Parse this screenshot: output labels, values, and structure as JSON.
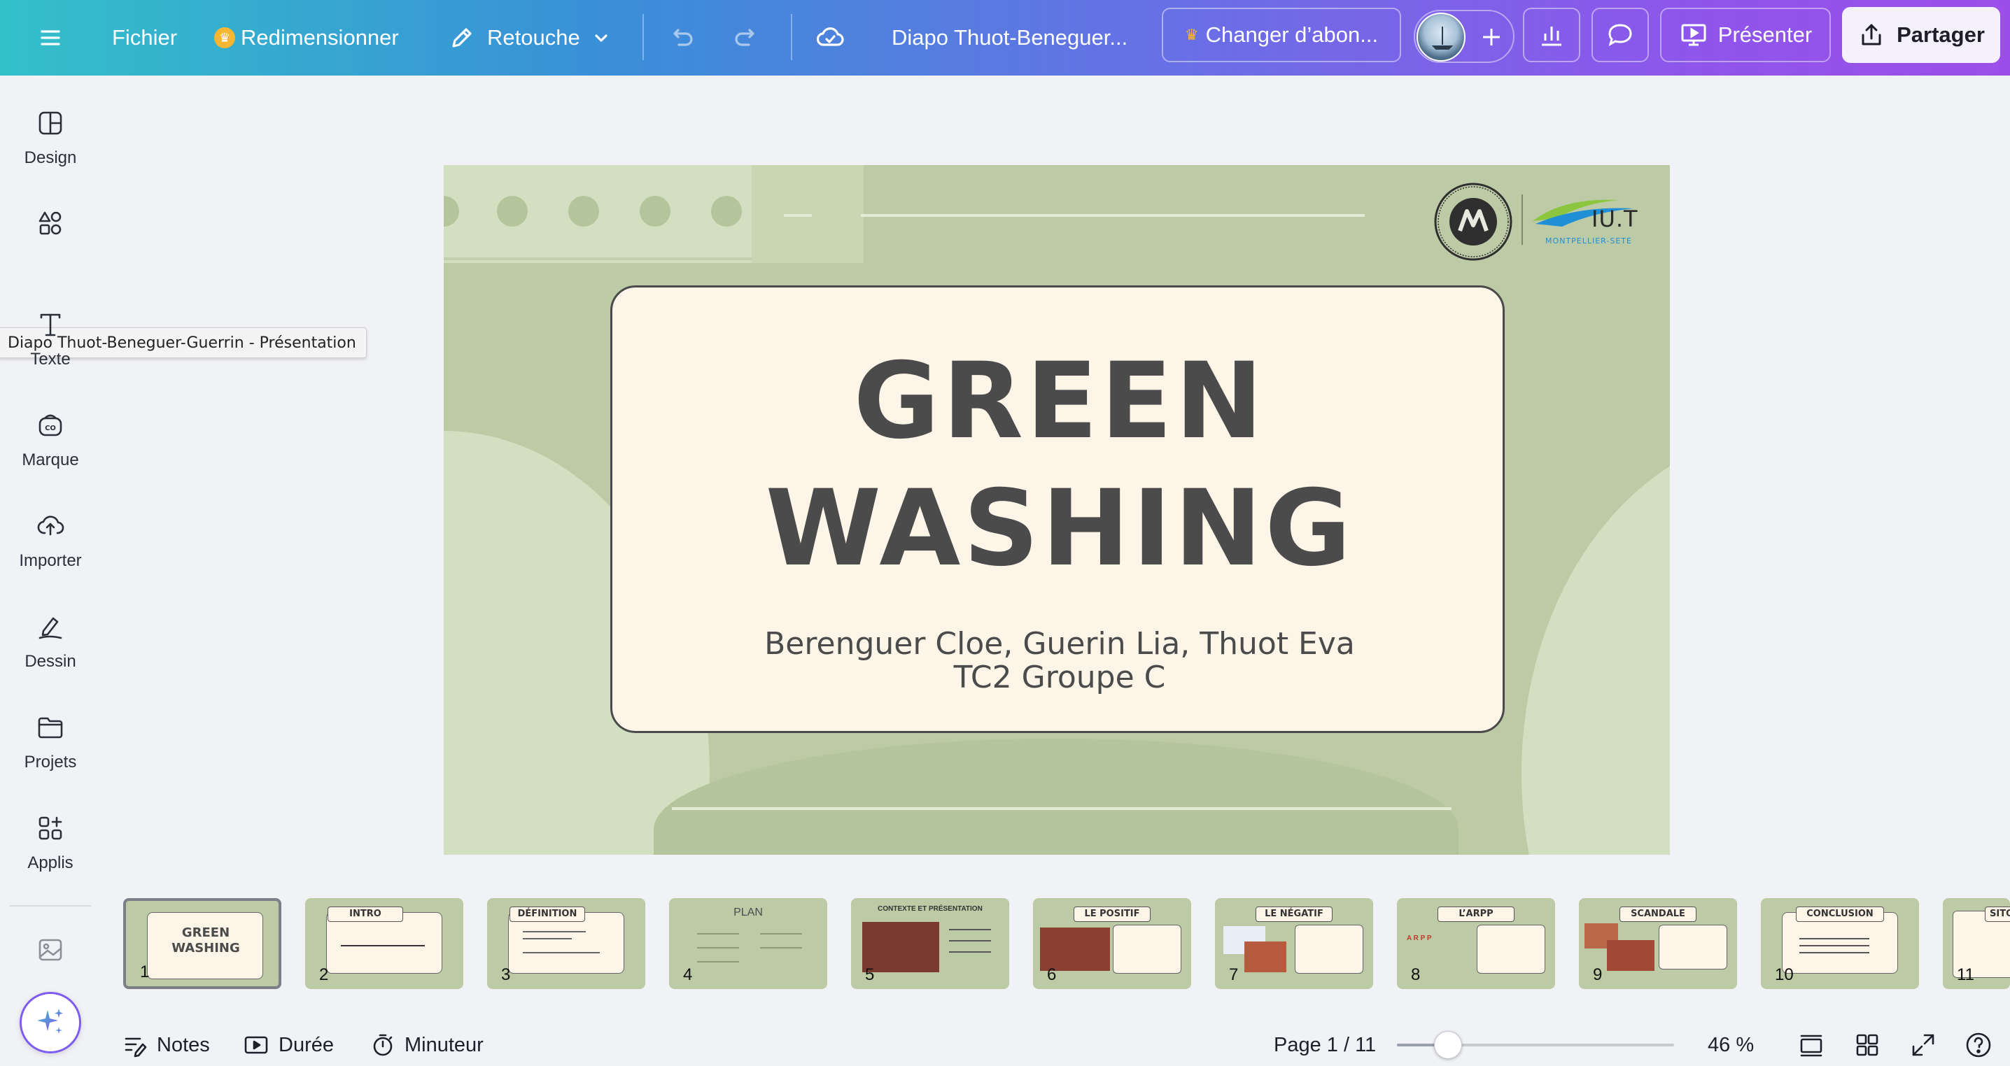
{
  "topbar": {
    "menu_icon": "hamburger-icon",
    "file_label": "Fichier",
    "resize_label": "Redimensionner",
    "edit_label": "Retouche",
    "doc_title": "Diapo Thuot-Beneguer...",
    "upgrade_label": "Changer d’abon...",
    "present_label": "Présenter",
    "share_label": "Partager"
  },
  "sidebar": {
    "items": [
      {
        "label": "Design",
        "icon": "layout-icon"
      },
      {
        "label": "",
        "icon": "elements-icon"
      },
      {
        "label": "Texte",
        "icon": "text-icon"
      },
      {
        "label": "Marque",
        "icon": "brand-icon"
      },
      {
        "label": "Importer",
        "icon": "upload-cloud-icon"
      },
      {
        "label": "Dessin",
        "icon": "draw-icon"
      },
      {
        "label": "Projets",
        "icon": "folder-icon"
      },
      {
        "label": "Applis",
        "icon": "apps-icon"
      }
    ],
    "tooltip": "Diapo Thuot-Beneguer-Guerrin - Présentation"
  },
  "slide": {
    "title_line1": "GREEN",
    "title_line2": "WASHING",
    "authors": "Berenguer Cloe, Guerin Lia, Thuot Eva",
    "group": "TC2 Groupe C",
    "iut_logo_text": "IU.T",
    "iut_logo_sub": "MONTPELLIER-SETE"
  },
  "thumbnails": [
    {
      "num": "1",
      "title": "GREEN WASHING",
      "type": "cover"
    },
    {
      "num": "2",
      "title": "INTRO",
      "type": "text"
    },
    {
      "num": "3",
      "title": "DÉFINITION",
      "type": "text"
    },
    {
      "num": "4",
      "title": "PLAN",
      "type": "plan"
    },
    {
      "num": "5",
      "title": "CONTEXTE ET PRÉSENTATION",
      "type": "image"
    },
    {
      "num": "6",
      "title": "LE POSITIF",
      "type": "image"
    },
    {
      "num": "7",
      "title": "LE NÉGATIF",
      "type": "image"
    },
    {
      "num": "8",
      "title": "L’ARPP",
      "type": "text"
    },
    {
      "num": "9",
      "title": "SCANDALE",
      "type": "image"
    },
    {
      "num": "10",
      "title": "CONCLUSION",
      "type": "text"
    },
    {
      "num": "11",
      "title": "SITO",
      "type": "text"
    }
  ],
  "bottombar": {
    "notes_label": "Notes",
    "duration_label": "Durée",
    "timer_label": "Minuteur",
    "page_label": "Page 1 / 11",
    "zoom_label": "46 %",
    "zoom_fraction": 0.46
  },
  "colors": {
    "slide_bg": "#bccaa6",
    "card_bg": "#fdf6e8",
    "title": "#4b4b4b"
  }
}
